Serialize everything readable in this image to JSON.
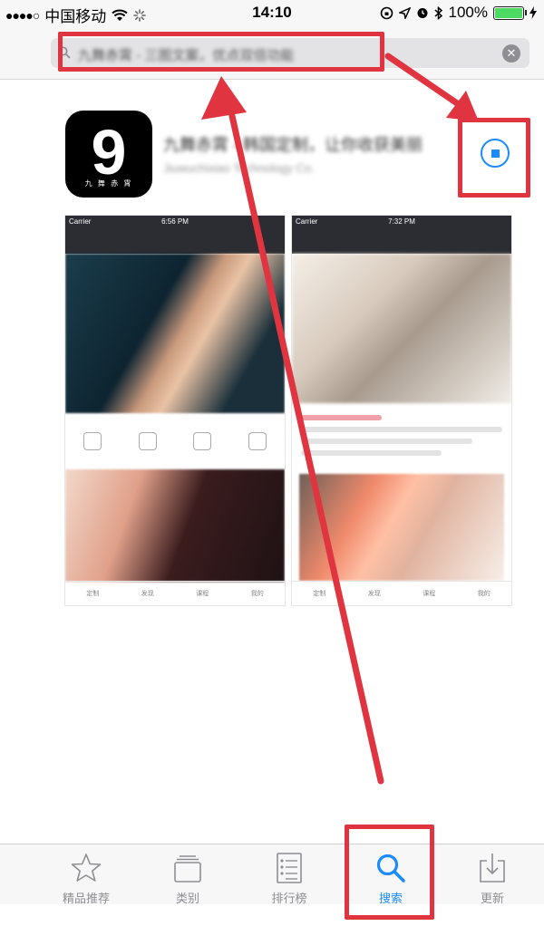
{
  "status_bar": {
    "signal": "●●●●○",
    "carrier": "中国移动",
    "time": "14:10",
    "battery_text": "100%",
    "battery_level": 1.0
  },
  "search": {
    "query": "九舞赤霄 - 三图文案，优点双倍功能"
  },
  "app": {
    "icon_text": "9",
    "icon_sub": "九 舞 赤 霄",
    "name": "九舞赤霄 - 韩国定制，让你收获美丽",
    "subtitle": "Jiuwuchixiao Technology Co."
  },
  "screenshots": [
    {
      "carrier": "Carrier",
      "time": "6:56 PM",
      "tabs": [
        "定制",
        "发现",
        "课程",
        "我的"
      ]
    },
    {
      "carrier": "Carrier",
      "time": "7:32 PM",
      "tabs": [
        "定制",
        "发现",
        "课程",
        "我的"
      ]
    }
  ],
  "tabbar": {
    "items": [
      {
        "label": "精品推荐",
        "icon": "star-icon"
      },
      {
        "label": "类别",
        "icon": "categories-icon"
      },
      {
        "label": "排行榜",
        "icon": "top-charts-icon"
      },
      {
        "label": "搜索",
        "icon": "search-icon"
      },
      {
        "label": "更新",
        "icon": "updates-icon"
      }
    ],
    "active_index": 3
  },
  "colors": {
    "accent": "#1a8cff",
    "annotation": "#e03540",
    "battery": "#4cd964"
  }
}
